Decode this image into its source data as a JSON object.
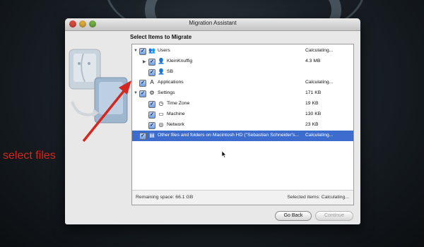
{
  "window": {
    "title": "Migration Assistant"
  },
  "heading": "Select Items to Migrate",
  "items": [
    {
      "label": "Users",
      "size": "Calculating...",
      "icon": "users-icon",
      "glyph": "👥",
      "expand": "▼",
      "level": 0,
      "selected": false
    },
    {
      "label": "KleinKnuffig",
      "size": "4.3 MB",
      "icon": "user-icon",
      "glyph": "👤",
      "expand": "▶",
      "level": 1,
      "selected": false
    },
    {
      "label": "SB",
      "size": "",
      "icon": "user-icon",
      "glyph": "👤",
      "expand": "",
      "level": 1,
      "selected": false
    },
    {
      "label": "Applications",
      "size": "Calculating...",
      "icon": "applications-icon",
      "glyph": "A",
      "expand": "",
      "level": 0,
      "selected": false
    },
    {
      "label": "Settings",
      "size": "171 KB",
      "icon": "gear-icon",
      "glyph": "⚙",
      "expand": "▼",
      "level": 0,
      "selected": false
    },
    {
      "label": "Time Zone",
      "size": "19 KB",
      "icon": "clock-icon",
      "glyph": "◷",
      "expand": "",
      "level": 1,
      "selected": false
    },
    {
      "label": "Machine",
      "size": "130 KB",
      "icon": "display-icon",
      "glyph": "▭",
      "expand": "",
      "level": 1,
      "selected": false
    },
    {
      "label": "Network",
      "size": "23 KB",
      "icon": "globe-icon",
      "glyph": "◎",
      "expand": "",
      "level": 1,
      "selected": false
    },
    {
      "label": "Other files and folders on Macintosh HD (\"Sebastian Schneider's...",
      "size": "Calculating...",
      "icon": "document-icon",
      "glyph": "▤",
      "expand": "",
      "level": 0,
      "selected": true
    }
  ],
  "status": {
    "remaining": "Remaining space: 66.1 GB",
    "selected": "Selected items: Calculating..."
  },
  "buttons": {
    "back": "Go Back",
    "continue": "Continue"
  },
  "annotation": {
    "text": "select files",
    "color": "#d3271f"
  },
  "colors": {
    "selection": "#3d6ccf",
    "accent": "#d3271f"
  }
}
